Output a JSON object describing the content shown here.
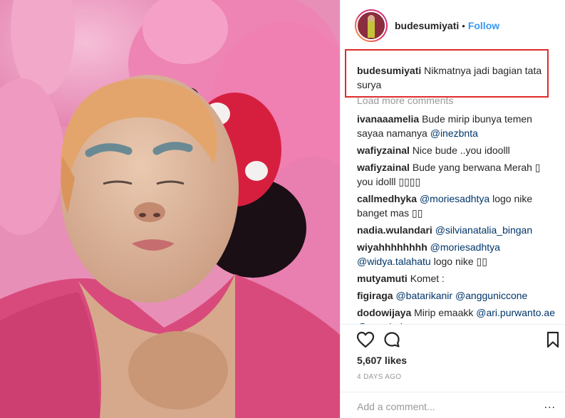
{
  "post": {
    "username": "budesumiyati",
    "follow_label": "Follow",
    "separator": "•",
    "caption_text": "Nikmatnya jadi bagian tata surya"
  },
  "comments": {
    "load_more_label": "Load more comments",
    "items": [
      {
        "user": "ivanaaamelia",
        "parts": [
          {
            "t": "Bude mirip ibunya temen sayaa namanya "
          },
          {
            "m": "@inezbnta"
          }
        ]
      },
      {
        "user": "wafiyzainal",
        "parts": [
          {
            "t": "Nice bude ..you idoolll"
          }
        ]
      },
      {
        "user": "wafiyzainal",
        "parts": [
          {
            "t": "Bude yang berwana Merah ▯ you idolll ▯▯▯▯"
          }
        ]
      },
      {
        "user": "callmedhyka",
        "parts": [
          {
            "m": "@moriesadhtya"
          },
          {
            "t": " logo nike banget mas ▯▯"
          }
        ]
      },
      {
        "user": "nadia.wulandari",
        "parts": [
          {
            "m": "@silvianatalia_bingan"
          }
        ]
      },
      {
        "user": "wiyahhhhhhhh",
        "parts": [
          {
            "m": "@moriesadhtya"
          },
          {
            "t": " "
          },
          {
            "m": "@widya.talahatu"
          },
          {
            "t": " logo nike ▯▯"
          }
        ]
      },
      {
        "user": "mutyamuti",
        "parts": [
          {
            "t": "Komet :"
          }
        ]
      },
      {
        "user": "figiraga",
        "parts": [
          {
            "m": "@batarikanir"
          },
          {
            "t": " "
          },
          {
            "m": "@angguniccone"
          }
        ]
      },
      {
        "user": "dodowijaya",
        "parts": [
          {
            "t": "Mirip emaakk "
          },
          {
            "m": "@ari.purwanto.ae"
          },
          {
            "t": " "
          },
          {
            "m": "@mazdarham"
          },
          {
            "t": " ▯▯"
          }
        ]
      }
    ]
  },
  "actions": {
    "likes_label": "5,607 likes",
    "time_label": "4 DAYS AGO",
    "add_comment_placeholder": "Add a comment...",
    "more_label": "..."
  },
  "icons": {
    "like": "heart-outline-icon",
    "comment": "speech-bubble-icon",
    "save": "bookmark-icon",
    "more": "more-dots-icon"
  },
  "colors": {
    "link_blue": "#3897f0",
    "mention": "#003569",
    "highlight_border": "#e02b2b",
    "muted": "#999999"
  }
}
